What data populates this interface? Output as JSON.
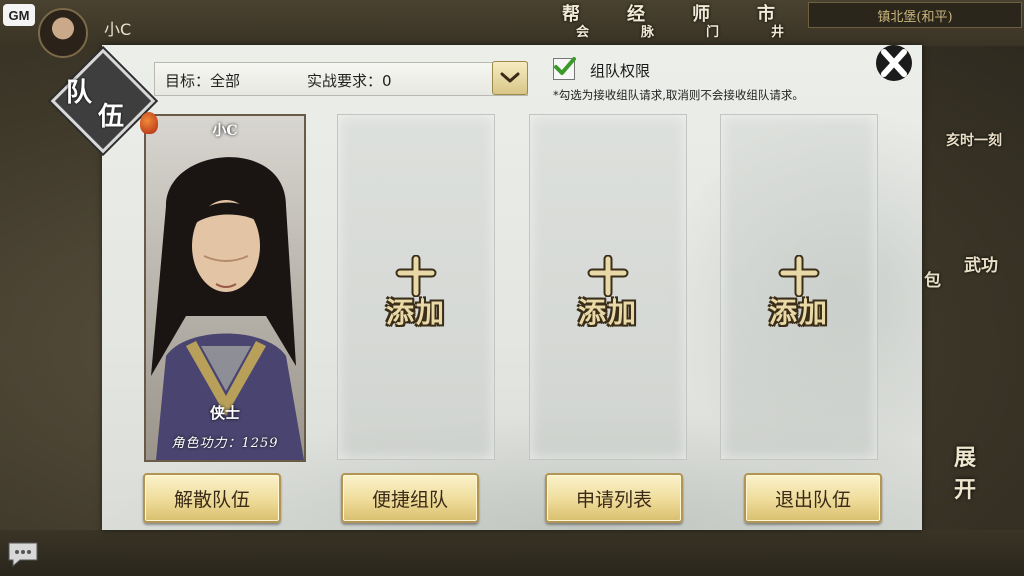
{
  "hud": {
    "gm_badge": "GM",
    "player_name": "小C",
    "top_buttons": [
      {
        "main": "帮",
        "sub": "会"
      },
      {
        "main": "经",
        "sub": "脉"
      },
      {
        "main": "师",
        "sub": "门"
      },
      {
        "main": "市",
        "sub": "井"
      }
    ],
    "location": "镇北堡(和平)",
    "right_text_1": "亥时一刻",
    "right_text_2": "包",
    "right_text_3": "武功",
    "expand_label": "展开"
  },
  "dialog": {
    "title_char_1": "队",
    "title_char_2": "伍",
    "filter": {
      "target_label": "目标：全部",
      "requirement_label": "实战要求：0"
    },
    "permission": {
      "label": "组队权限",
      "checked": true,
      "hint": "*勾选为接收组队请求,取消则不会接收组队请求。"
    },
    "member": {
      "name": "小C",
      "title": "侠士",
      "power_label": "角色功力：1259"
    },
    "empty_slots": [
      {
        "label": "添加"
      },
      {
        "label": "添加"
      },
      {
        "label": "添加"
      }
    ],
    "buttons": {
      "disband": "解散队伍",
      "quick_team": "便捷组队",
      "apply_list": "申请列表",
      "leave": "退出队伍"
    }
  },
  "colors": {
    "button_gold": "#efdc9a",
    "slot_label": "#e9d9a6",
    "title_badge": "#3e3e3e",
    "check_green": "#3c9a2a"
  },
  "icons": [
    "gm-badge",
    "chat-bubble-icon",
    "close-icon",
    "chevron-down-icon",
    "checkmark-icon",
    "plus-icon",
    "tassel-icon"
  ]
}
